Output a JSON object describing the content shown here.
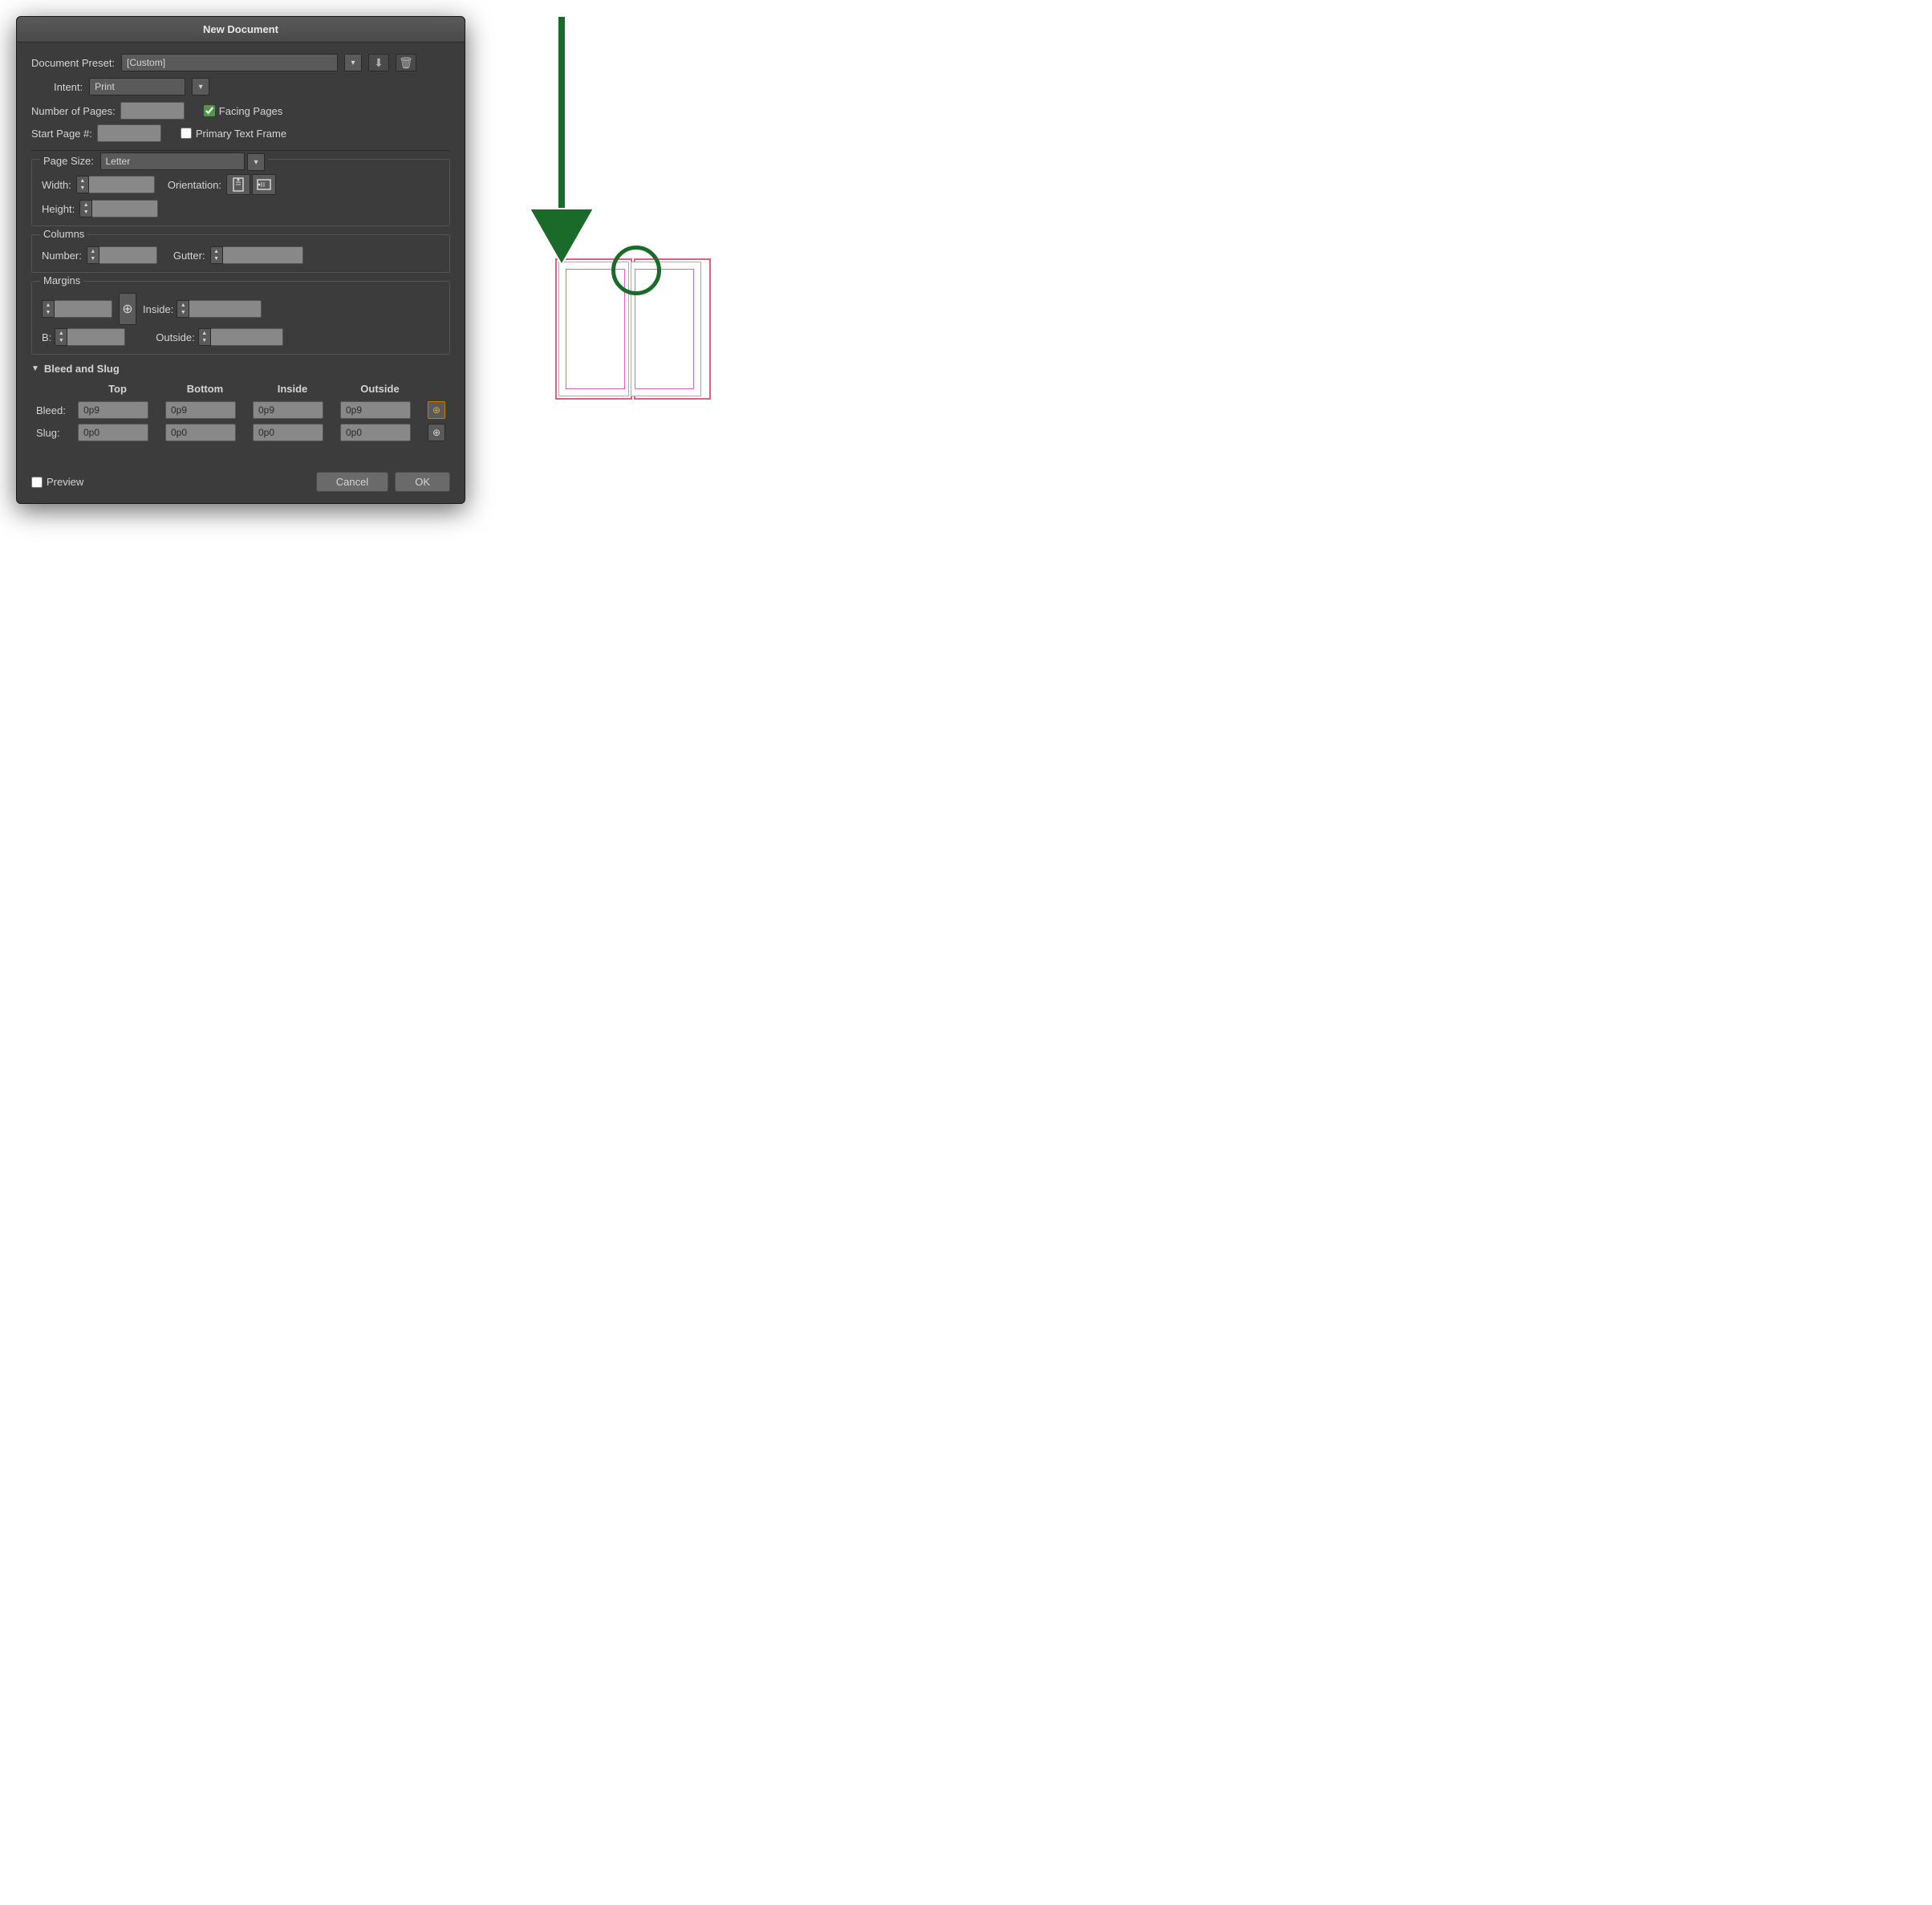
{
  "dialog": {
    "title": "New Document"
  },
  "preset": {
    "label": "Document Preset:",
    "value": "[Custom]",
    "save_title": "Save preset",
    "delete_title": "Delete preset"
  },
  "intent": {
    "label": "Intent:",
    "value": "Print"
  },
  "pages": {
    "number_label": "Number of Pages:",
    "start_label": "Start Page #:",
    "facing_label": "Facing Pages",
    "primary_label": "Primary Text Frame"
  },
  "page_size": {
    "section_label": "Page Size:",
    "value": "Letter",
    "width_label": "Width:",
    "height_label": "Height:",
    "orientation_label": "Orientation:"
  },
  "columns": {
    "section_label": "Columns",
    "number_label": "Number:",
    "gutter_label": "Gutter:"
  },
  "margins": {
    "section_label": "Margins",
    "inside_label": "Inside:",
    "outside_label": "Outside:"
  },
  "bleed_slug": {
    "title": "Bleed and Slug",
    "top_label": "Top",
    "bottom_label": "Bottom",
    "inside_label": "Inside",
    "outside_label": "Outside",
    "bleed_label": "Bleed:",
    "slug_label": "Slug:",
    "bleed_top": "0p9",
    "bleed_bottom": "0p9",
    "bleed_inside": "0p9",
    "bleed_outside": "0p9",
    "slug_top": "0p0",
    "slug_bottom": "0p0",
    "slug_inside": "0p0",
    "slug_outside": "0p0"
  },
  "footer": {
    "preview_label": "Preview",
    "cancel_label": "Cancel",
    "ok_label": "OK"
  }
}
